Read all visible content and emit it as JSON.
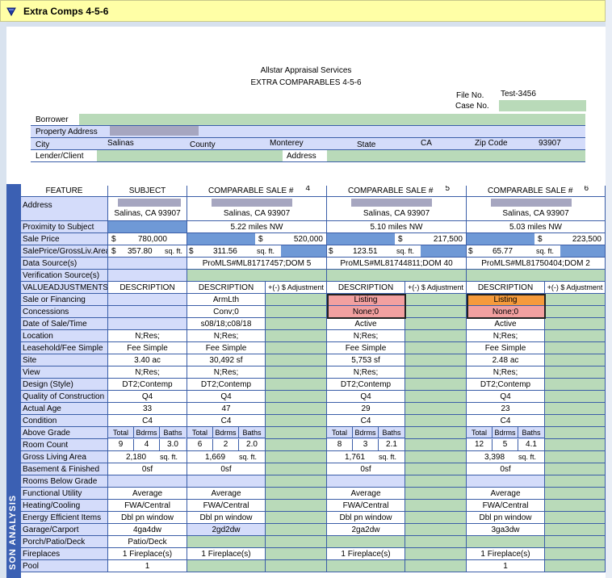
{
  "window": {
    "title": "Extra Comps 4-5-6"
  },
  "header": {
    "company": "Allstar Appraisal Services",
    "subtitle": "EXTRA COMPARABLES 4-5-6",
    "file_no_label": "File No.",
    "file_no": "Test-3456",
    "case_no_label": "Case No."
  },
  "info": {
    "borrower_label": "Borrower",
    "property_address_label": "Property Address",
    "city_label": "City",
    "city": "Salinas",
    "county_label": "County",
    "county": "Monterey",
    "state_label": "State",
    "state": "CA",
    "zip_label": "Zip Code",
    "zip": "93907",
    "lender_label": "Lender/Client",
    "address_label": "Address"
  },
  "sidebar_text": "SON ANALYSIS",
  "grid": {
    "headers": {
      "feature": "FEATURE",
      "subject": "SUBJECT",
      "comp_label": "COMPARABLE SALE #",
      "comp_numbers": [
        "4",
        "5",
        "6"
      ],
      "description": "DESCRIPTION",
      "adjustment": "+(-) $ Adjustment"
    },
    "subject": {
      "city_line": "Salinas, CA 93907",
      "sale_price_symbol": "$",
      "sale_price": "780,000",
      "price_sqft_symbol": "$",
      "price_sqft": "357.80",
      "sqft_unit": "sq. ft.",
      "financing": "",
      "concessions": "",
      "date_of_sale": "",
      "location": "N;Res;",
      "leasehold": "Fee Simple",
      "site": "3.40 ac",
      "view": "N;Res;",
      "design": "DT2;Contemp",
      "quality": "Q4",
      "age": "33",
      "condition": "C4",
      "total": "9",
      "bdrms": "4",
      "baths": "3.0",
      "gla": "2,180",
      "basement": "0sf",
      "functional": "Average",
      "heating": "FWA/Central",
      "energy": "Dbl pn window",
      "garage": "4ga4dw",
      "porch": "Patio/Deck",
      "fireplaces": "1 Fireplace(s)",
      "pool": "1"
    },
    "comps": [
      {
        "city_line": "Salinas, CA 93907",
        "proximity": "5.22 miles NW",
        "sale_price": "520,000",
        "price_sqft": "311.56",
        "data_source": "ProMLS#ML81717457;DOM 5",
        "financing": "ArmLth",
        "concessions": "Conv;0",
        "date_of_sale": "s08/18;c08/18",
        "location": "N;Res;",
        "leasehold": "Fee Simple",
        "site": "30,492 sf",
        "view": "N;Res;",
        "design": "DT2;Contemp",
        "quality": "Q4",
        "age": "47",
        "condition": "C4",
        "total": "6",
        "bdrms": "2",
        "baths": "2.0",
        "gla": "1,669",
        "basement": "0sf",
        "functional": "Average",
        "heating": "FWA/Central",
        "energy": "Dbl pn window",
        "garage": "2gd2dw",
        "porch": "",
        "fireplaces": "1 Fireplace(s)",
        "pool": ""
      },
      {
        "city_line": "Salinas, CA 93907",
        "proximity": "5.10 miles NW",
        "sale_price": "217,500",
        "price_sqft": "123.51",
        "data_source": "ProMLS#ML81744811;DOM 40",
        "financing": "Listing",
        "concessions": "None;0",
        "date_of_sale": "Active",
        "location": "N;Res;",
        "leasehold": "Fee Simple",
        "site": "5,753 sf",
        "view": "N;Res;",
        "design": "DT2;Contemp",
        "quality": "Q4",
        "age": "29",
        "condition": "C4",
        "total": "8",
        "bdrms": "3",
        "baths": "2.1",
        "gla": "1,761",
        "basement": "0sf",
        "functional": "Average",
        "heating": "FWA/Central",
        "energy": "Dbl pn window",
        "garage": "2ga2dw",
        "porch": "",
        "fireplaces": "1 Fireplace(s)",
        "pool": ""
      },
      {
        "city_line": "Salinas, CA 93907",
        "proximity": "5.03 miles NW",
        "sale_price": "223,500",
        "price_sqft": "65.77",
        "data_source": "ProMLS#ML81750404;DOM 2",
        "financing": "Listing",
        "concessions": "None;0",
        "date_of_sale": "Active",
        "location": "N;Res;",
        "leasehold": "Fee Simple",
        "site": "2.48 ac",
        "view": "N;Res;",
        "design": "DT2;Contemp",
        "quality": "Q4",
        "age": "23",
        "condition": "C4",
        "total": "12",
        "bdrms": "5",
        "baths": "4.1",
        "gla": "3,398",
        "basement": "0sf",
        "functional": "Average",
        "heating": "FWA/Central",
        "energy": "Dbl pn window",
        "garage": "3ga3dw",
        "porch": "",
        "fireplaces": "1 Fireplace(s)",
        "pool": "1"
      }
    ],
    "row_labels": {
      "address": "Address",
      "proximity": "Proximity to Subject",
      "sale_price": "Sale Price",
      "price_sqft": "SalePrice/GrossLiv.Area",
      "data_source": "Data Source(s)",
      "verification": "Verification Source(s)",
      "value_adj": "VALUEADJUSTMENTS",
      "financing": "Sale or Financing",
      "concessions": "Concessions",
      "date_of_sale": "Date of Sale/Time",
      "location": "Location",
      "leasehold": "Leasehold/Fee Simple",
      "site": "Site",
      "view": "View",
      "design": "Design (Style)",
      "quality": "Quality of Construction",
      "age": "Actual Age",
      "condition": "Condition",
      "above_grade": "Above Grade",
      "room_count": "Room Count",
      "gla": "Gross Living Area",
      "basement": "Basement & Finished",
      "rooms_below": "Rooms Below Grade",
      "functional": "Functional Utility",
      "heating": "Heating/Cooling",
      "energy": "Energy Efficient Items",
      "garage": "Garage/Carport",
      "porch": "Porch/Patio/Deck",
      "fireplaces": "Fireplaces",
      "pool": "Pool"
    },
    "room_headers": {
      "total": "Total",
      "bdrms": "Bdrms",
      "baths": "Baths"
    },
    "dollar": "$"
  },
  "colors": {
    "title_bar": "#ffffa6",
    "field_green": "#b9dab9",
    "row_lavender": "#d4dcfa",
    "grid_blue": "#3b5ea8",
    "cell_blue": "#6f99d6",
    "highlight_pink": "#f2a0a0",
    "highlight_orange": "#f59a3c"
  }
}
